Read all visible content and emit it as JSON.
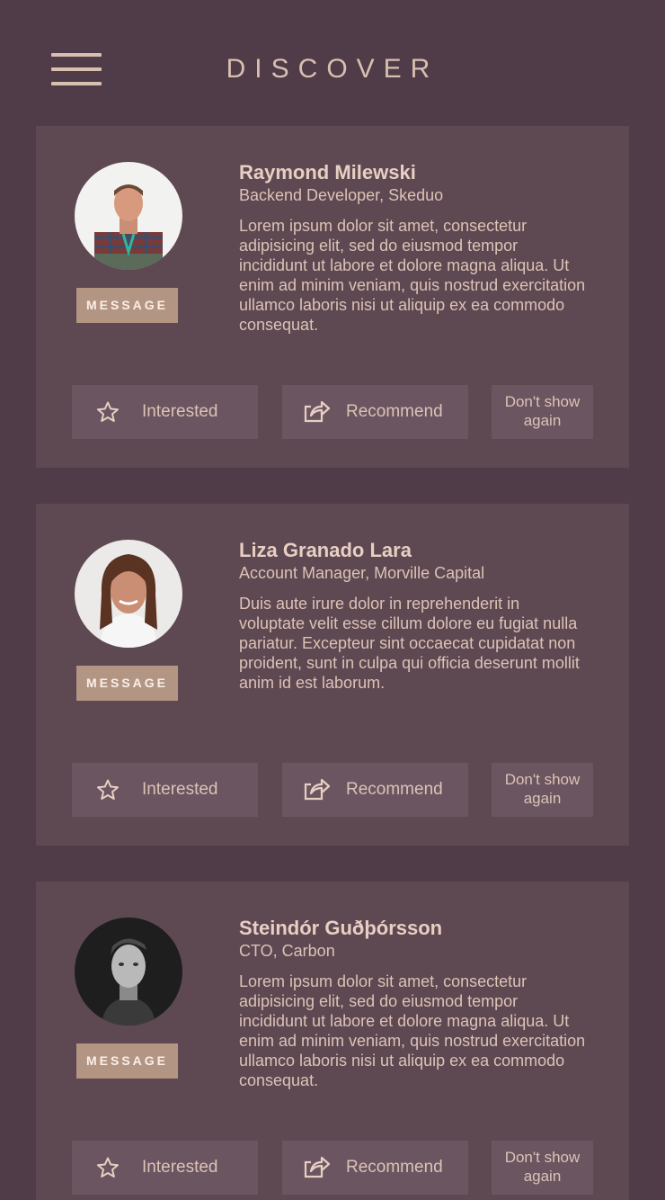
{
  "header": {
    "title": "DISCOVER",
    "menu_icon": "hamburger-menu-icon"
  },
  "colors": {
    "background": "#4f3c48",
    "card": "#5e4852",
    "button": "#6b5560",
    "accent": "#b39584",
    "text": "#e8cfc3"
  },
  "cards": [
    {
      "name": "Raymond Milewski",
      "role": "Backend Developer, Skeduo",
      "bio": "Lorem ipsum dolor sit amet, consectetur adipisicing elit, sed do eiusmod tempor incididunt ut labore et dolore magna aliqua. Ut enim ad minim veniam, quis nostrud exercitation ullamco laboris nisi ut aliquip ex ea commodo consequat.",
      "message_label": "MESSAGE",
      "interested_label": "Interested",
      "recommend_label": "Recommend",
      "dont_show_label": "Don't show again"
    },
    {
      "name": "Liza Granado Lara",
      "role": "Account Manager, Morville Capital",
      "bio": "Duis aute irure dolor in reprehenderit in voluptate velit esse cillum dolore eu fugiat nulla pariatur. Excepteur sint occaecat cupidatat non proident, sunt in culpa qui officia deserunt mollit anim id est laborum.",
      "message_label": "MESSAGE",
      "interested_label": "Interested",
      "recommend_label": "Recommend",
      "dont_show_label": "Don't show again"
    },
    {
      "name": "Steindór Guðþórsson",
      "role": "CTO, Carbon",
      "bio": "Lorem ipsum dolor sit amet, consectetur adipisicing elit, sed do eiusmod tempor incididunt ut labore et dolore magna aliqua. Ut enim ad minim veniam, quis nostrud exercitation ullamco laboris nisi ut aliquip ex ea commodo consequat.",
      "message_label": "MESSAGE",
      "interested_label": "Interested",
      "recommend_label": "Recommend",
      "dont_show_label": "Don't show again"
    }
  ]
}
